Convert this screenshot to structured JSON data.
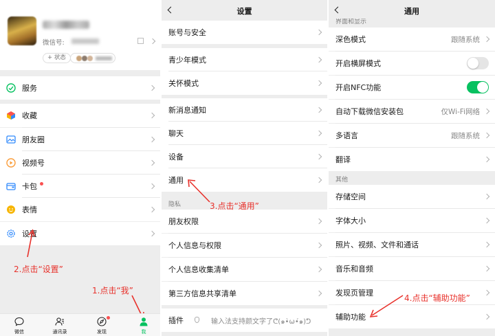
{
  "colors": {
    "accent": "#07c160",
    "annotation": "#e8312b",
    "badge": "#fa5151"
  },
  "me": {
    "wechat_id_label": "微信号:",
    "status_button": "+ 状态",
    "menu": [
      {
        "label": "服务",
        "icon": "services-icon"
      },
      {
        "label": "收藏",
        "icon": "favorites-icon"
      },
      {
        "label": "朋友圈",
        "icon": "moments-icon"
      },
      {
        "label": "视频号",
        "icon": "channels-icon"
      },
      {
        "label": "卡包",
        "icon": "card-wallet-icon"
      },
      {
        "label": "表情",
        "icon": "stickers-icon"
      },
      {
        "label": "设置",
        "icon": "settings-icon"
      }
    ],
    "tabs": [
      {
        "label": "微信",
        "icon": "chat-icon"
      },
      {
        "label": "通讯录",
        "icon": "contacts-icon"
      },
      {
        "label": "发现",
        "icon": "discover-icon"
      },
      {
        "label": "我",
        "icon": "me-icon"
      }
    ]
  },
  "settings": {
    "title": "设置",
    "items": [
      "账号与安全",
      "青少年模式",
      "关怀模式",
      "新消息通知",
      "聊天",
      "设备",
      "通用"
    ],
    "privacy_section": "隐私",
    "privacy_items": [
      "朋友权限",
      "个人信息与权限",
      "个人信息收集清单",
      "第三方信息共享清单"
    ],
    "plugins_label": "插件",
    "plugins_input": "输入法支持颜文字了ᕦ(๑•̀ω•́๑)ᕤ"
  },
  "general": {
    "title": "通用",
    "display_section_partial": "界面和显示",
    "items": [
      {
        "label": "深色模式",
        "value": "跟随系统"
      },
      {
        "label": "开启横屏模式"
      },
      {
        "label": "开启NFC功能"
      },
      {
        "label": "自动下载微信安装包",
        "value": "仅Wi-Fi网络"
      },
      {
        "label": "多语言",
        "value": "跟随系统"
      },
      {
        "label": "翻译"
      }
    ],
    "other_section": "其他",
    "other_items": [
      "存储空间",
      "字体大小",
      "照片、视频、文件和通话",
      "音乐和音频",
      "发现页管理",
      "辅助功能"
    ]
  },
  "annotations": {
    "step1": "1.点击“我”",
    "step2": "2.点击“设置”",
    "step3": "3.点击“通用”",
    "step4": "4.点击“辅助功能”"
  }
}
